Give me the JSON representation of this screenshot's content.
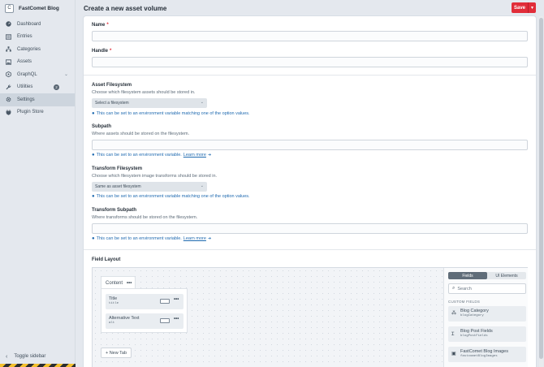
{
  "site": {
    "initial": "C",
    "name": "FastComet Blog"
  },
  "nav": [
    {
      "label": "Dashboard",
      "icon": "dashboard-icon"
    },
    {
      "label": "Entries",
      "icon": "entries-icon"
    },
    {
      "label": "Categories",
      "icon": "categories-icon"
    },
    {
      "label": "Assets",
      "icon": "assets-icon"
    },
    {
      "label": "GraphQL",
      "icon": "graphql-icon"
    },
    {
      "label": "Utilities",
      "icon": "wrench-icon",
      "badge": "2"
    },
    {
      "label": "Settings",
      "icon": "gear-icon",
      "active": true
    },
    {
      "label": "Plugin Store",
      "icon": "plug-icon"
    }
  ],
  "toggle_sidebar": "Toggle sidebar",
  "header": {
    "title": "Create a new asset volume",
    "save_label": "Save"
  },
  "form": {
    "name_label": "Name",
    "handle_label": "Handle",
    "filesystem_label": "Asset Filesystem",
    "filesystem_desc": "Choose which filesystem assets should be stored in.",
    "filesystem_value": "Select a filesystem",
    "filesystem_tip": "This can be set to an environment variable matching one of the option values.",
    "subpath_label": "Subpath",
    "subpath_desc": "Where assets should be stored on the filesystem.",
    "subpath_tip": "This can be set to an environment variable.",
    "learn_more": "Learn more",
    "transform_fs_label": "Transform Filesystem",
    "transform_fs_desc": "Choose which filesystem image transforms should be stored in.",
    "transform_fs_value": "Same as asset filesystem",
    "transform_fs_tip": "This can be set to an environment variable matching one of the option values.",
    "transform_subpath_label": "Transform Subpath",
    "transform_subpath_desc": "Where transforms should be stored on the filesystem.",
    "transform_subpath_tip": "This can be set to an environment variable.",
    "field_layout_label": "Field Layout"
  },
  "designer": {
    "tab_name": "Content",
    "fields": [
      {
        "name": "Title",
        "handle": "title"
      },
      {
        "name": "Alternative Text",
        "handle": "alt"
      }
    ],
    "new_tab": "+ New Tab",
    "panel_tabs": [
      "Fields",
      "UI Elements"
    ],
    "search_placeholder": "Search",
    "custom_fields_heading": "CUSTOM FIELDS",
    "custom_fields": [
      {
        "name": "Blog Category",
        "handle": "blogCategory",
        "icon": "categories-icon"
      },
      {
        "name": "Blog Post Fields",
        "handle": "blogPostFields",
        "icon": "text-cursor-icon"
      },
      {
        "name": "FastComet Blog Images",
        "handle": "fastcometBlogImages",
        "icon": "image-icon"
      }
    ]
  },
  "colors": {
    "accent": "#e12d39",
    "link": "#1f6ab0"
  }
}
